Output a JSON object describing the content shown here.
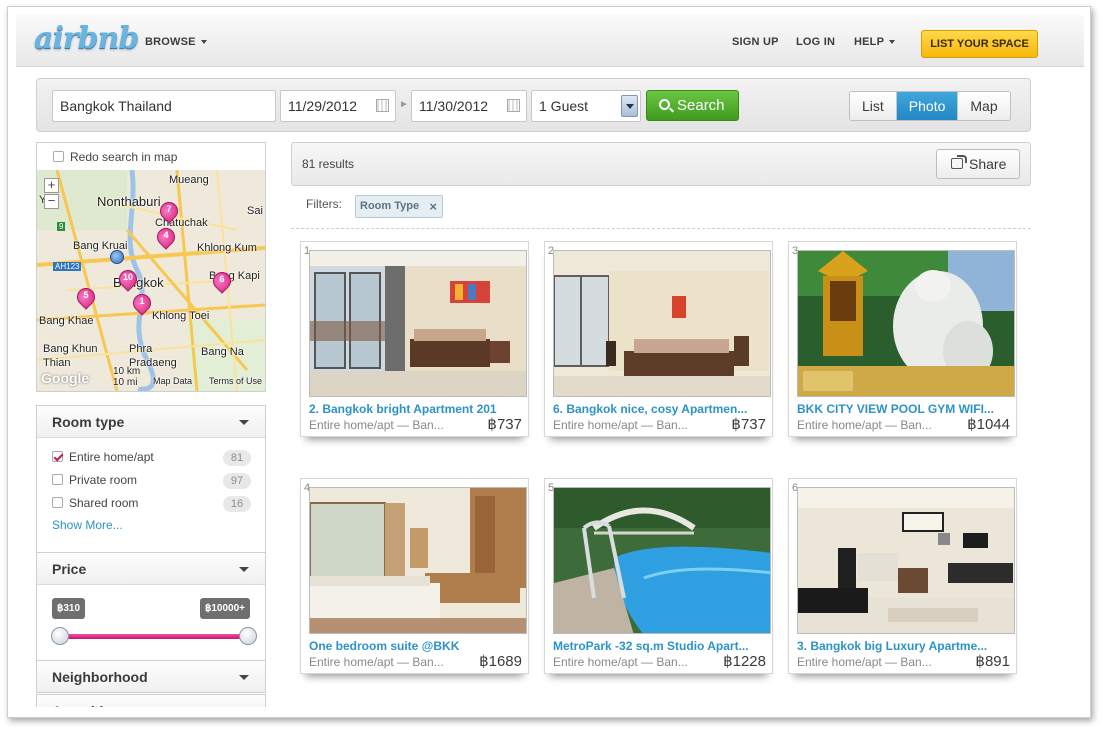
{
  "header": {
    "logo": "airbnb",
    "browse": "BROWSE",
    "sign_up": "SIGN UP",
    "log_in": "LOG IN",
    "help": "HELP",
    "list_space": "LIST YOUR SPACE"
  },
  "search": {
    "location": "Bangkok Thailand",
    "checkin": "11/29/2012",
    "checkout": "11/30/2012",
    "guests": "1 Guest",
    "button": "Search",
    "views": [
      "List",
      "Photo",
      "Map"
    ],
    "active_view": "Photo"
  },
  "map": {
    "redo_label": "Redo search in map",
    "labels": [
      "Mueang",
      "Nonthaburi",
      "Yai",
      "Chatuchak",
      "Sai",
      "Bang Kruai",
      "Khlong Kum",
      "AH123",
      "Bangkok",
      "Bang Kapi",
      "Bang Khae",
      "Khlong Toei",
      "Bang Khun Thian",
      "Phra Pradaeng",
      "Bang Na",
      "10 km",
      "10 mi",
      "Map Data",
      "Terms of Use",
      "Google",
      "9"
    ],
    "pins": [
      "7",
      "4",
      "10",
      "5",
      "1",
      "6"
    ]
  },
  "filters_panel": {
    "room_type": {
      "title": "Room type",
      "options": [
        {
          "label": "Entire home/apt",
          "count": "81",
          "checked": true
        },
        {
          "label": "Private room",
          "count": "97",
          "checked": false
        },
        {
          "label": "Shared room",
          "count": "16",
          "checked": false
        }
      ],
      "show_more": "Show More..."
    },
    "price": {
      "title": "Price",
      "min": "฿310",
      "max": "฿10000+"
    },
    "neighborhood": "Neighborhood",
    "amenities": "Amenities"
  },
  "results": {
    "count_text": "81 results",
    "share": "Share",
    "filters_label": "Filters:",
    "active_filter": "Room Type"
  },
  "listings": [
    {
      "num": "1",
      "title": "2. Bangkok bright Apartment 201",
      "sub": "Entire home/apt — Ban...",
      "price": "฿737"
    },
    {
      "num": "2",
      "title": "6. Bangkok nice, cosy Apartmen...",
      "sub": "Entire home/apt — Ban...",
      "price": "฿737"
    },
    {
      "num": "3",
      "title": "BKK CITY VIEW POOL GYM WIFI...",
      "sub": "Entire home/apt — Ban...",
      "price": "฿1044"
    },
    {
      "num": "4",
      "title": "One bedroom suite @BKK",
      "sub": "Entire home/apt — Ban...",
      "price": "฿1689"
    },
    {
      "num": "5",
      "title": "MetroPark -32 sq.m Studio Apart...",
      "sub": "Entire home/apt — Ban...",
      "price": "฿1228"
    },
    {
      "num": "6",
      "title": "3. Bangkok big Luxury Apartme...",
      "sub": "Entire home/apt — Ban...",
      "price": "฿891"
    }
  ]
}
